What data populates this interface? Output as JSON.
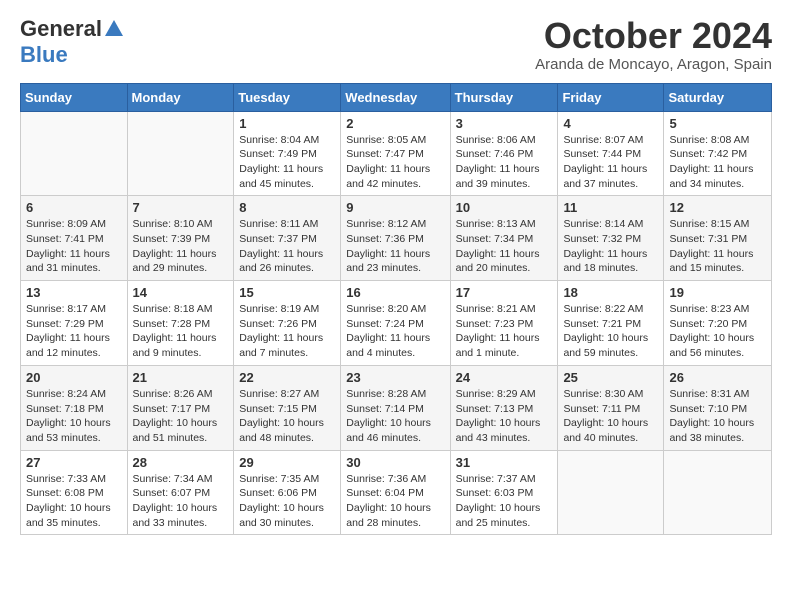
{
  "header": {
    "logo_general": "General",
    "logo_blue": "Blue",
    "month_title": "October 2024",
    "location": "Aranda de Moncayo, Aragon, Spain"
  },
  "weekdays": [
    "Sunday",
    "Monday",
    "Tuesday",
    "Wednesday",
    "Thursday",
    "Friday",
    "Saturday"
  ],
  "weeks": [
    [
      {
        "day": "",
        "sunrise": "",
        "sunset": "",
        "daylight": ""
      },
      {
        "day": "",
        "sunrise": "",
        "sunset": "",
        "daylight": ""
      },
      {
        "day": "1",
        "sunrise": "Sunrise: 8:04 AM",
        "sunset": "Sunset: 7:49 PM",
        "daylight": "Daylight: 11 hours and 45 minutes."
      },
      {
        "day": "2",
        "sunrise": "Sunrise: 8:05 AM",
        "sunset": "Sunset: 7:47 PM",
        "daylight": "Daylight: 11 hours and 42 minutes."
      },
      {
        "day": "3",
        "sunrise": "Sunrise: 8:06 AM",
        "sunset": "Sunset: 7:46 PM",
        "daylight": "Daylight: 11 hours and 39 minutes."
      },
      {
        "day": "4",
        "sunrise": "Sunrise: 8:07 AM",
        "sunset": "Sunset: 7:44 PM",
        "daylight": "Daylight: 11 hours and 37 minutes."
      },
      {
        "day": "5",
        "sunrise": "Sunrise: 8:08 AM",
        "sunset": "Sunset: 7:42 PM",
        "daylight": "Daylight: 11 hours and 34 minutes."
      }
    ],
    [
      {
        "day": "6",
        "sunrise": "Sunrise: 8:09 AM",
        "sunset": "Sunset: 7:41 PM",
        "daylight": "Daylight: 11 hours and 31 minutes."
      },
      {
        "day": "7",
        "sunrise": "Sunrise: 8:10 AM",
        "sunset": "Sunset: 7:39 PM",
        "daylight": "Daylight: 11 hours and 29 minutes."
      },
      {
        "day": "8",
        "sunrise": "Sunrise: 8:11 AM",
        "sunset": "Sunset: 7:37 PM",
        "daylight": "Daylight: 11 hours and 26 minutes."
      },
      {
        "day": "9",
        "sunrise": "Sunrise: 8:12 AM",
        "sunset": "Sunset: 7:36 PM",
        "daylight": "Daylight: 11 hours and 23 minutes."
      },
      {
        "day": "10",
        "sunrise": "Sunrise: 8:13 AM",
        "sunset": "Sunset: 7:34 PM",
        "daylight": "Daylight: 11 hours and 20 minutes."
      },
      {
        "day": "11",
        "sunrise": "Sunrise: 8:14 AM",
        "sunset": "Sunset: 7:32 PM",
        "daylight": "Daylight: 11 hours and 18 minutes."
      },
      {
        "day": "12",
        "sunrise": "Sunrise: 8:15 AM",
        "sunset": "Sunset: 7:31 PM",
        "daylight": "Daylight: 11 hours and 15 minutes."
      }
    ],
    [
      {
        "day": "13",
        "sunrise": "Sunrise: 8:17 AM",
        "sunset": "Sunset: 7:29 PM",
        "daylight": "Daylight: 11 hours and 12 minutes."
      },
      {
        "day": "14",
        "sunrise": "Sunrise: 8:18 AM",
        "sunset": "Sunset: 7:28 PM",
        "daylight": "Daylight: 11 hours and 9 minutes."
      },
      {
        "day": "15",
        "sunrise": "Sunrise: 8:19 AM",
        "sunset": "Sunset: 7:26 PM",
        "daylight": "Daylight: 11 hours and 7 minutes."
      },
      {
        "day": "16",
        "sunrise": "Sunrise: 8:20 AM",
        "sunset": "Sunset: 7:24 PM",
        "daylight": "Daylight: 11 hours and 4 minutes."
      },
      {
        "day": "17",
        "sunrise": "Sunrise: 8:21 AM",
        "sunset": "Sunset: 7:23 PM",
        "daylight": "Daylight: 11 hours and 1 minute."
      },
      {
        "day": "18",
        "sunrise": "Sunrise: 8:22 AM",
        "sunset": "Sunset: 7:21 PM",
        "daylight": "Daylight: 10 hours and 59 minutes."
      },
      {
        "day": "19",
        "sunrise": "Sunrise: 8:23 AM",
        "sunset": "Sunset: 7:20 PM",
        "daylight": "Daylight: 10 hours and 56 minutes."
      }
    ],
    [
      {
        "day": "20",
        "sunrise": "Sunrise: 8:24 AM",
        "sunset": "Sunset: 7:18 PM",
        "daylight": "Daylight: 10 hours and 53 minutes."
      },
      {
        "day": "21",
        "sunrise": "Sunrise: 8:26 AM",
        "sunset": "Sunset: 7:17 PM",
        "daylight": "Daylight: 10 hours and 51 minutes."
      },
      {
        "day": "22",
        "sunrise": "Sunrise: 8:27 AM",
        "sunset": "Sunset: 7:15 PM",
        "daylight": "Daylight: 10 hours and 48 minutes."
      },
      {
        "day": "23",
        "sunrise": "Sunrise: 8:28 AM",
        "sunset": "Sunset: 7:14 PM",
        "daylight": "Daylight: 10 hours and 46 minutes."
      },
      {
        "day": "24",
        "sunrise": "Sunrise: 8:29 AM",
        "sunset": "Sunset: 7:13 PM",
        "daylight": "Daylight: 10 hours and 43 minutes."
      },
      {
        "day": "25",
        "sunrise": "Sunrise: 8:30 AM",
        "sunset": "Sunset: 7:11 PM",
        "daylight": "Daylight: 10 hours and 40 minutes."
      },
      {
        "day": "26",
        "sunrise": "Sunrise: 8:31 AM",
        "sunset": "Sunset: 7:10 PM",
        "daylight": "Daylight: 10 hours and 38 minutes."
      }
    ],
    [
      {
        "day": "27",
        "sunrise": "Sunrise: 7:33 AM",
        "sunset": "Sunset: 6:08 PM",
        "daylight": "Daylight: 10 hours and 35 minutes."
      },
      {
        "day": "28",
        "sunrise": "Sunrise: 7:34 AM",
        "sunset": "Sunset: 6:07 PM",
        "daylight": "Daylight: 10 hours and 33 minutes."
      },
      {
        "day": "29",
        "sunrise": "Sunrise: 7:35 AM",
        "sunset": "Sunset: 6:06 PM",
        "daylight": "Daylight: 10 hours and 30 minutes."
      },
      {
        "day": "30",
        "sunrise": "Sunrise: 7:36 AM",
        "sunset": "Sunset: 6:04 PM",
        "daylight": "Daylight: 10 hours and 28 minutes."
      },
      {
        "day": "31",
        "sunrise": "Sunrise: 7:37 AM",
        "sunset": "Sunset: 6:03 PM",
        "daylight": "Daylight: 10 hours and 25 minutes."
      },
      {
        "day": "",
        "sunrise": "",
        "sunset": "",
        "daylight": ""
      },
      {
        "day": "",
        "sunrise": "",
        "sunset": "",
        "daylight": ""
      }
    ]
  ]
}
